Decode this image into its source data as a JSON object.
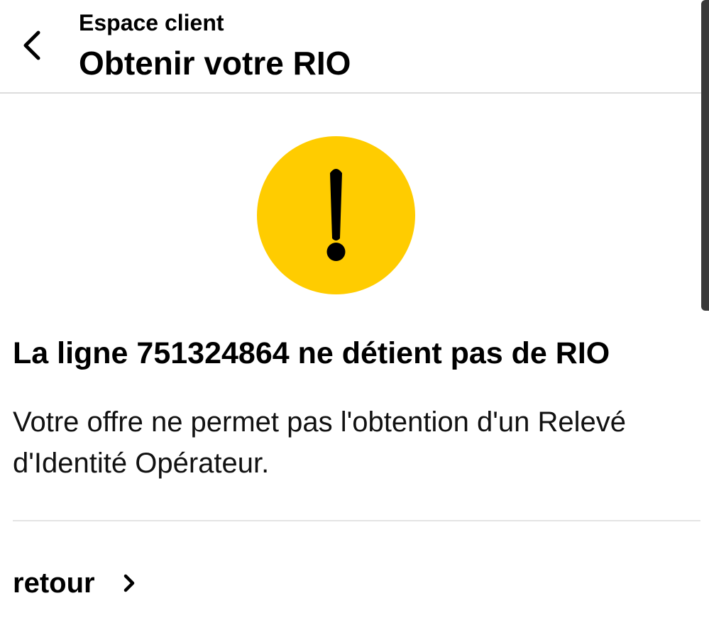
{
  "header": {
    "subtitle": "Espace client",
    "title": "Obtenir votre RIO",
    "back_icon": "chevron-left-icon"
  },
  "result": {
    "icon": "warning-icon",
    "icon_color": "#FFCC00",
    "title": "La ligne 751324864 ne détient pas de RIO",
    "description": "Votre offre ne permet pas l'obtention d'un Relevé d'Identité Opérateur."
  },
  "actions": {
    "back_link_label": "retour",
    "back_link_icon": "chevron-right-icon"
  }
}
